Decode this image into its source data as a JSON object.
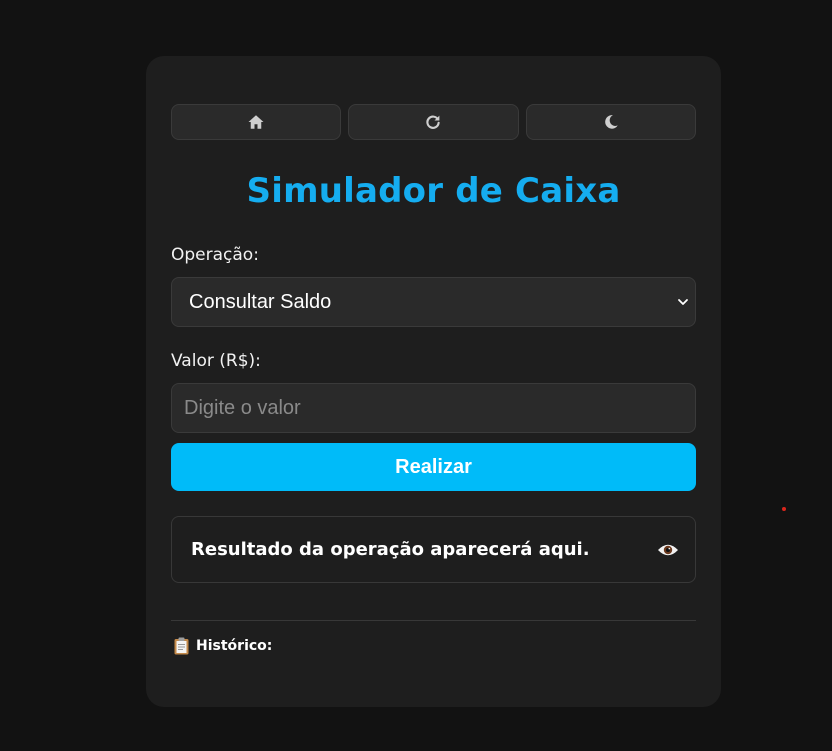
{
  "app": {
    "title": "Simulador de Caixa"
  },
  "toolbar": {
    "buttons": [
      {
        "icon": "home-icon"
      },
      {
        "icon": "refresh-icon"
      },
      {
        "icon": "moon-icon"
      }
    ]
  },
  "form": {
    "operation_label": "Operação:",
    "operation_selected": "Consultar Saldo",
    "value_label": "Valor (R$):",
    "value_input": "",
    "value_placeholder": "Digite o valor",
    "submit_label": "Realizar"
  },
  "result": {
    "text": "Resultado da operação aparecerá aqui.",
    "icon": "eye-icon"
  },
  "history": {
    "icon": "clipboard-icon",
    "label": "Histórico:"
  },
  "colors": {
    "page_background": "#121212",
    "card_background": "#1e1e1e",
    "accent": "#15adf0",
    "button": "#00bbf9"
  }
}
